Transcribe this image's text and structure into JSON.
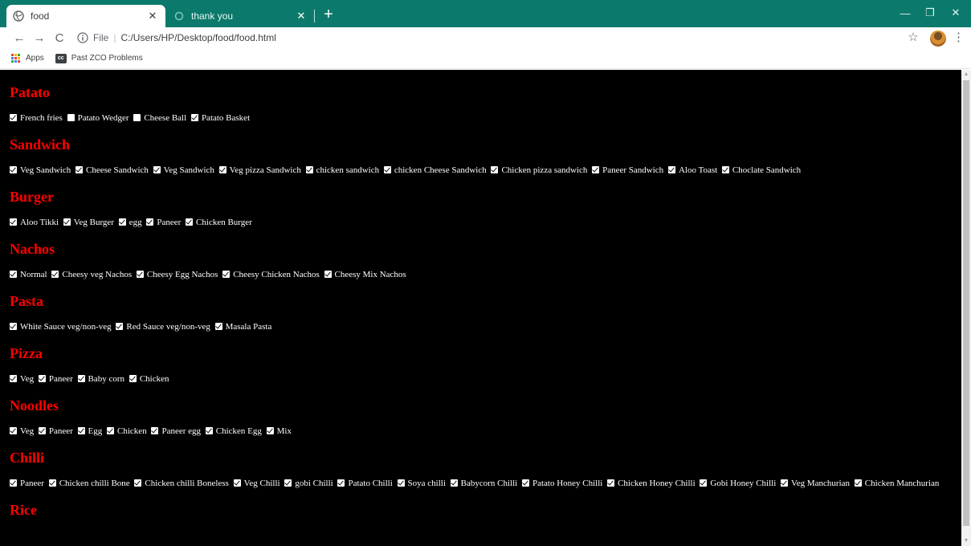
{
  "browser": {
    "tabs": [
      {
        "title": "food",
        "close": "✕"
      },
      {
        "title": "thank you",
        "close": "✕"
      }
    ],
    "new_tab": "+",
    "window": {
      "minimize": "—",
      "maximize": "❐",
      "close": "✕"
    },
    "nav": {
      "back": "←",
      "forward": "→",
      "reload": "C"
    },
    "address": {
      "scheme": "File",
      "separator": "|",
      "path": "C:/Users/HP/Desktop/food/food.html"
    },
    "star": "☆",
    "menu": "⋮",
    "bookmarks": [
      {
        "label": "Apps",
        "icon": "apps-grid-icon"
      },
      {
        "label": "Past ZCO Problems",
        "icon_text": "cc"
      }
    ]
  },
  "colors": {
    "tabstrip": "#0b7a6c",
    "page_bg": "#000000",
    "heading": "#ff0000",
    "text": "#ffffff"
  },
  "menu_sections": [
    {
      "title": "Patato",
      "items": [
        {
          "label": "French fries",
          "checked": true
        },
        {
          "label": "Patato Wedger",
          "checked": false
        },
        {
          "label": "Cheese Ball",
          "checked": false
        },
        {
          "label": "Patato Basket",
          "checked": true
        }
      ]
    },
    {
      "title": "Sandwich",
      "items": [
        {
          "label": "Veg Sandwich",
          "checked": true
        },
        {
          "label": "Cheese Sandwich",
          "checked": true
        },
        {
          "label": "Veg Sandwich",
          "checked": true
        },
        {
          "label": "Veg pizza Sandwich",
          "checked": true
        },
        {
          "label": "chicken sandwich",
          "checked": true
        },
        {
          "label": "chicken Cheese Sandwich",
          "checked": true
        },
        {
          "label": "Chicken pizza sandwich",
          "checked": true
        },
        {
          "label": "Paneer Sandwich",
          "checked": true
        },
        {
          "label": "Aloo Toast",
          "checked": true
        },
        {
          "label": "Choclate Sandwich",
          "checked": true
        }
      ]
    },
    {
      "title": "Burger",
      "items": [
        {
          "label": "Aloo Tikki",
          "checked": true
        },
        {
          "label": "Veg Burger",
          "checked": true
        },
        {
          "label": "egg",
          "checked": true
        },
        {
          "label": "Paneer",
          "checked": true
        },
        {
          "label": "Chicken Burger",
          "checked": true
        }
      ]
    },
    {
      "title": "Nachos",
      "items": [
        {
          "label": "Normal",
          "checked": true
        },
        {
          "label": "Cheesy veg Nachos",
          "checked": true
        },
        {
          "label": "Cheesy Egg Nachos",
          "checked": true
        },
        {
          "label": "Cheesy Chicken Nachos",
          "checked": true
        },
        {
          "label": "Cheesy Mix Nachos",
          "checked": true
        }
      ]
    },
    {
      "title": "Pasta",
      "items": [
        {
          "label": "White Sauce veg/non-veg",
          "checked": true
        },
        {
          "label": "Red Sauce veg/non-veg",
          "checked": true
        },
        {
          "label": "Masala Pasta",
          "checked": true
        }
      ]
    },
    {
      "title": "Pizza",
      "items": [
        {
          "label": "Veg",
          "checked": true
        },
        {
          "label": "Paneer",
          "checked": true
        },
        {
          "label": "Baby corn",
          "checked": true
        },
        {
          "label": "Chicken",
          "checked": true
        }
      ]
    },
    {
      "title": "Noodles",
      "items": [
        {
          "label": "Veg",
          "checked": true
        },
        {
          "label": "Paneer",
          "checked": true
        },
        {
          "label": "Egg",
          "checked": true
        },
        {
          "label": "Chicken",
          "checked": true
        },
        {
          "label": "Paneer egg",
          "checked": true
        },
        {
          "label": "Chicken Egg",
          "checked": true
        },
        {
          "label": "Mix",
          "checked": true
        }
      ]
    },
    {
      "title": "Chilli",
      "items": [
        {
          "label": "Paneer",
          "checked": true
        },
        {
          "label": "Chicken chilli Bone",
          "checked": true
        },
        {
          "label": "Chicken chilli Boneless",
          "checked": true
        },
        {
          "label": "Veg Chilli",
          "checked": true
        },
        {
          "label": "gobi Chilli",
          "checked": true
        },
        {
          "label": "Patato Chilli",
          "checked": true
        },
        {
          "label": "Soya chilli",
          "checked": true
        },
        {
          "label": "Babycorn Chilli",
          "checked": true
        },
        {
          "label": "Patato Honey Chilli",
          "checked": true
        },
        {
          "label": "Chicken Honey Chilli",
          "checked": true
        },
        {
          "label": "Gobi Honey Chilli",
          "checked": true
        },
        {
          "label": "Veg Manchurian",
          "checked": true
        },
        {
          "label": "Chicken Manchurian",
          "checked": true
        }
      ]
    },
    {
      "title": "Rice",
      "items": []
    }
  ]
}
